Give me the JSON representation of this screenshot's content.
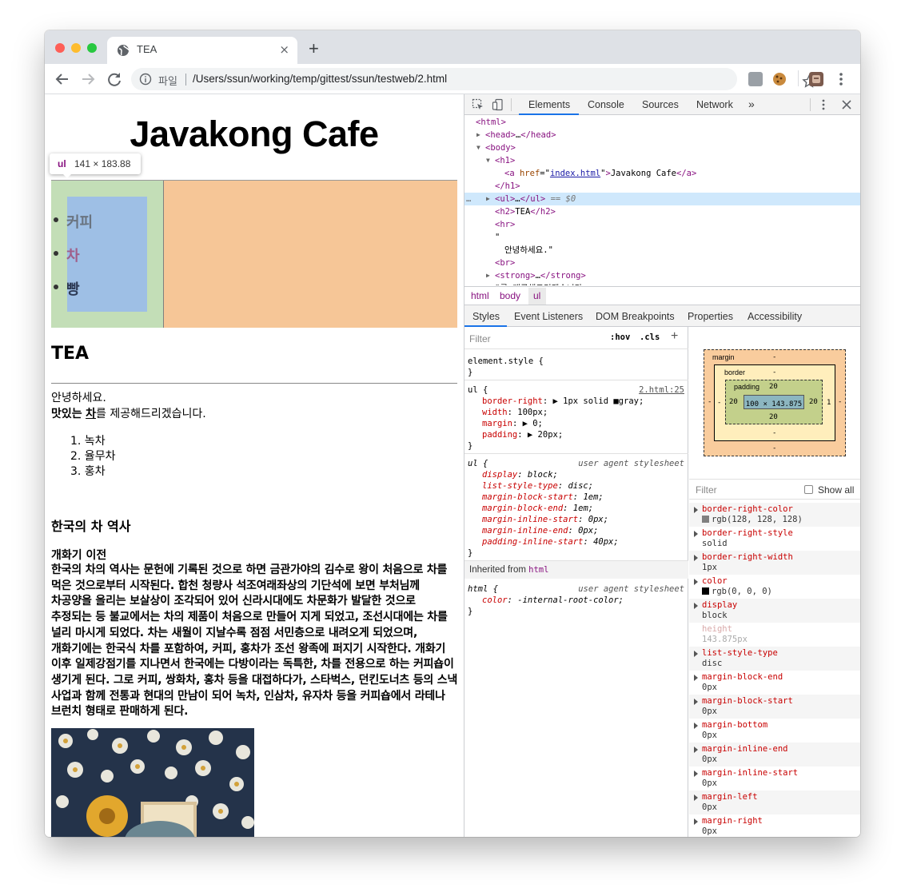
{
  "browser": {
    "tab_title": "TEA",
    "tab_close": "×",
    "new_tab": "+",
    "omnibox_label": "파일",
    "url": "/Users/ssun/working/temp/gittest/ssun/testweb/2.html"
  },
  "page": {
    "title": "Javakong Cafe",
    "tooltip_tag": "ul",
    "tooltip_dims": "141 × 183.88",
    "menu_items": [
      "커피",
      "차",
      "빵"
    ],
    "menu_colors": [
      "#6a7480",
      "#a05f8a",
      "#2d3a55"
    ],
    "h2": "TEA",
    "greeting": "안녕하세요.",
    "intro_bold": "맛있는",
    "intro_strong": "차",
    "intro_rest": "를 제공해드리겠습니다.",
    "ol_items": [
      "1. 녹차",
      "2. 율무차",
      "3. 홍차"
    ],
    "history_title": "한국의 차 역사",
    "history_subtitle": "개화기 이전",
    "history_text": "한국의 차의 역사는 문헌에 기록된 것으로 하면 금관가야의 김수로 왕이 처음으로 차를 먹은 것으로부터 시작된다. 합천 청량사 석조여래좌상의 기단석에 보면 부처님께 차공양을 올리는 보살상이 조각되어 있어 신라시대에도 차문화가 발달한 것으로 추정되는 등 불교에서는 차의 제품이 처음으로 만들어 지게 되었고, 조선시대에는 차를 널리 마시게 되었다. 차는 새월이 지날수록 점점 서민층으로 내려오게 되었으며, 개화기에는 한국식 차를 포함하여, 커피, 홍차가 조선 왕족에 퍼지기 시작한다. 개화기 이후 일제강점기를 지나면서 한국에는 다방이라는 독특한, 차를 전용으로 하는 커피숍이 생기게 된다. 그로 커피, 쌍화차, 홍차 등을 대접하다가, 스타벅스, 던킨도너츠 등의 스낵 사업과 함께 전통과 현대의 만남이 되어 녹차, 인삼차, 유자차 등을 커피숍에서 라테나 브런치 형태로 판매하게 된다."
  },
  "devtools": {
    "tabs": [
      "Elements",
      "Console",
      "Sources",
      "Network",
      "»"
    ],
    "tree": [
      {
        "indent": 0,
        "arrow": "",
        "text": "<html>"
      },
      {
        "indent": 1,
        "arrow": "▶",
        "text": "<head>…</head>"
      },
      {
        "indent": 1,
        "arrow": "▼",
        "text": "<body>"
      },
      {
        "indent": 2,
        "arrow": "▼",
        "text": "<h1>"
      },
      {
        "indent": 3,
        "arrow": "",
        "text": "<a href=\"index.html\">Javakong Cafe</a>"
      },
      {
        "indent": 2,
        "arrow": "",
        "text": "</h1>"
      },
      {
        "indent": 2,
        "arrow": "▶",
        "text": "<ul>…</ul> == $0"
      },
      {
        "indent": 2,
        "arrow": "",
        "text": "<h2>TEA</h2>"
      },
      {
        "indent": 2,
        "arrow": "",
        "text": "<hr>"
      },
      {
        "indent": 2,
        "arrow": "",
        "text": "\""
      },
      {
        "indent": 3,
        "arrow": "",
        "text": "안녕하세요.\""
      },
      {
        "indent": 2,
        "arrow": "",
        "text": "<br>"
      },
      {
        "indent": 2,
        "arrow": "▶",
        "text": "<strong>…</strong>"
      },
      {
        "indent": 2,
        "arrow": "",
        "text": "\"를 제공해드리겠습니다"
      }
    ],
    "breadcrumbs": [
      "html",
      "body",
      "ul"
    ],
    "subtabs": [
      "Styles",
      "Event Listeners",
      "DOM Breakpoints",
      "Properties",
      "Accessibility"
    ],
    "filter_placeholder": "Filter",
    "hov": ":hov",
    "cls": ".cls",
    "plus": "+",
    "element_style": "element.style {",
    "close_brace": "}",
    "ul_selector": "ul {",
    "ul_source": "2.html:25",
    "ul_props": [
      [
        "border-right",
        "▶ 1px solid ■gray;"
      ],
      [
        "width",
        "100px;"
      ],
      [
        "margin",
        "▶ 0;"
      ],
      [
        "padding",
        "▶ 20px;"
      ]
    ],
    "ua_selector": "ul {",
    "ua_source": "user agent stylesheet",
    "ua_props": [
      [
        "display",
        "block;"
      ],
      [
        "list-style-type",
        "disc;"
      ],
      [
        "margin-block-start",
        "1em;"
      ],
      [
        "margin-block-end",
        "1em;"
      ],
      [
        "margin-inline-start",
        "0px;"
      ],
      [
        "margin-inline-end",
        "0px;"
      ],
      [
        "padding-inline-start",
        "40px;"
      ]
    ],
    "inherited_label": "Inherited from",
    "inherited_tag": "html",
    "html_selector": "html {",
    "html_source": "user agent stylesheet",
    "html_prop": [
      "color",
      "-internal-root-color;"
    ],
    "boxmodel": {
      "margin_label": "margin",
      "margin_val": "-",
      "border_label": "border",
      "border_val": "-",
      "padding_label": "padding",
      "padding_val": "20",
      "content": "100 × 143.875",
      "left_pad": "20",
      "right_pad": "20",
      "bottom_pad": "20",
      "right_border": "1",
      "side_dash": "-"
    },
    "computed_filter": "Filter",
    "show_all": "Show all",
    "computed": [
      [
        "border-right-color",
        "rgb(128, 128, 128)"
      ],
      [
        "border-right-style",
        "solid"
      ],
      [
        "border-right-width",
        "1px"
      ],
      [
        "color",
        "rgb(0, 0, 0)"
      ],
      [
        "display",
        "block"
      ],
      [
        "height",
        "143.875px"
      ],
      [
        "list-style-type",
        "disc"
      ],
      [
        "margin-block-end",
        "0px"
      ],
      [
        "margin-block-start",
        "0px"
      ],
      [
        "margin-bottom",
        "0px"
      ],
      [
        "margin-inline-end",
        "0px"
      ],
      [
        "margin-inline-start",
        "0px"
      ],
      [
        "margin-left",
        "0px"
      ],
      [
        "margin-right",
        "0px"
      ]
    ]
  }
}
